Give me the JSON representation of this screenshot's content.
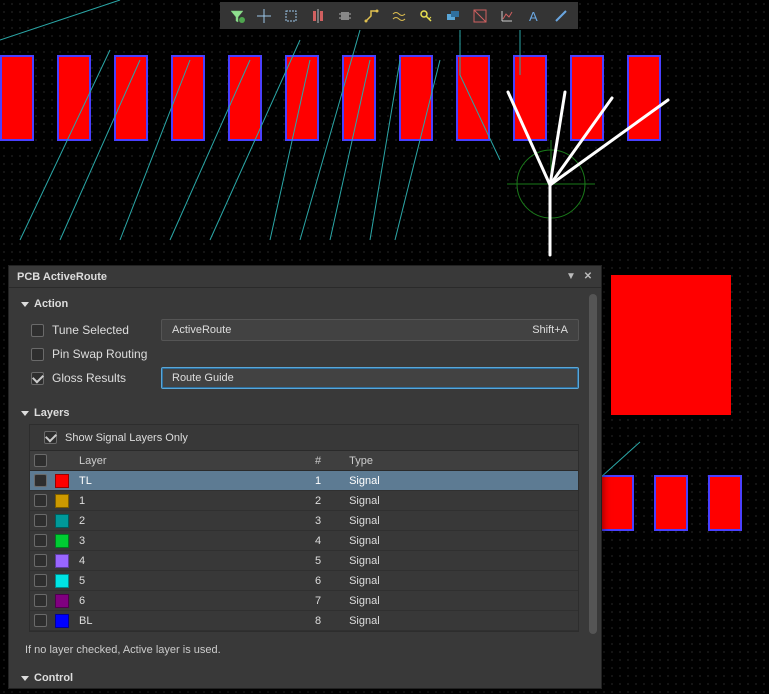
{
  "panel": {
    "title": "PCB ActiveRoute",
    "sections": {
      "action": "Action",
      "layers": "Layers",
      "control": "Control"
    },
    "action": {
      "tune_selected": "Tune Selected",
      "pin_swap": "Pin Swap Routing",
      "gloss": "Gloss Results",
      "activeroute_btn": "ActiveRoute",
      "activeroute_shortcut": "Shift+A",
      "route_guide_btn": "Route Guide"
    },
    "layers": {
      "show_signal_only": "Show Signal Layers Only",
      "columns": {
        "layer": "Layer",
        "num": "#",
        "type": "Type"
      },
      "rows": [
        {
          "color": "#ff0000",
          "name": "TL",
          "num": "1",
          "type": "Signal",
          "selected": true
        },
        {
          "color": "#cc9900",
          "name": "1",
          "num": "2",
          "type": "Signal",
          "selected": false
        },
        {
          "color": "#009999",
          "name": "2",
          "num": "3",
          "type": "Signal",
          "selected": false
        },
        {
          "color": "#00cc33",
          "name": "3",
          "num": "4",
          "type": "Signal",
          "selected": false
        },
        {
          "color": "#9966ff",
          "name": "4",
          "num": "5",
          "type": "Signal",
          "selected": false
        },
        {
          "color": "#00e5e5",
          "name": "5",
          "num": "6",
          "type": "Signal",
          "selected": false
        },
        {
          "color": "#800080",
          "name": "6",
          "num": "7",
          "type": "Signal",
          "selected": false
        },
        {
          "color": "#0000ff",
          "name": "BL",
          "num": "8",
          "type": "Signal",
          "selected": false
        }
      ],
      "footnote": "If no layer checked, Active layer is used."
    }
  },
  "toolbar": {
    "icons": [
      "filter-icon",
      "crosshair-icon",
      "rectangle-select-icon",
      "align-icon",
      "ic-icon",
      "route-icon",
      "diff-pair-icon",
      "key-icon",
      "layer-flip-icon",
      "measure-icon",
      "graph-icon",
      "text-icon",
      "line-icon"
    ]
  }
}
